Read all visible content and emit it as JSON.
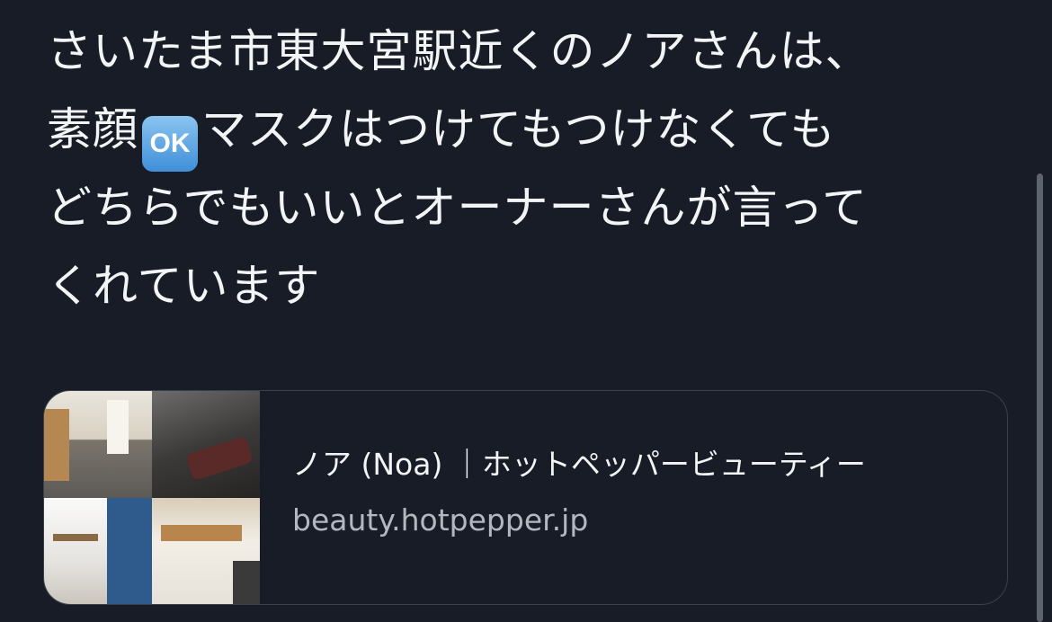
{
  "tweet": {
    "lines": [
      "さいたま市東大宮駅近くのノアさんは、",
      "素顔",
      "マスクはつけてもつけなくても",
      "どちらでもいいとオーナーさんが言って",
      "くれています"
    ],
    "emoji_label": "OK"
  },
  "link_card": {
    "title": "ノア (Noa) ｜ホットペッパービューティー",
    "domain": "beauty.hotpepper.jp"
  },
  "colors": {
    "background": "#171c26",
    "text": "#f3f4f6",
    "secondary_text": "#b3b8c0",
    "card_border": "#3a414c"
  }
}
